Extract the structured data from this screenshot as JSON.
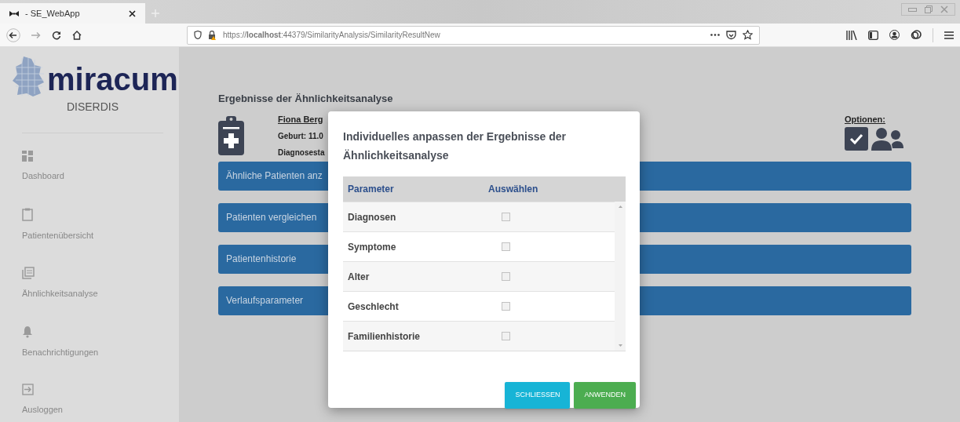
{
  "browser": {
    "tab_title": "- SE_WebApp",
    "url": "https://**localhost**:44379/SimilarityAnalysis/SimilarityResultNew"
  },
  "sidebar": {
    "logo": "miracum",
    "subtitle": "DISERDIS",
    "items": [
      {
        "kind": "dashboard",
        "label": "Dashboard"
      },
      {
        "kind": "clipboard",
        "label": "Patientenübersicht"
      },
      {
        "kind": "stack",
        "label": "Ähnlichkeitsanalyse"
      },
      {
        "kind": "bell",
        "label": "Benachrichtigungen"
      },
      {
        "kind": "logout",
        "label": "Ausloggen"
      }
    ]
  },
  "page": {
    "title": "Ergebnisse der Ähnlichkeitsanalyse",
    "patient_name": "Fiona Berg",
    "birth": "Geburt: 11.0",
    "diagnosis_status": "Diagnosesta",
    "options_label": "Optionen:",
    "actions": [
      "Ähnliche Patienten anz",
      "Patienten vergleichen",
      "Patientenhistorie",
      "Verlaufsparameter"
    ]
  },
  "dialog": {
    "title": "Individuelles anpassen der Ergebnisse der Ähnlichkeitsanalyse",
    "columns": [
      "Parameter",
      "Auswählen"
    ],
    "rows": [
      {
        "parameter": "Diagnosen",
        "checked": false
      },
      {
        "parameter": "Symptome",
        "checked": false
      },
      {
        "parameter": "Alter",
        "checked": false
      },
      {
        "parameter": "Geschlecht",
        "checked": false
      },
      {
        "parameter": "Familienhistorie",
        "checked": false
      }
    ],
    "buttons": [
      {
        "kind": "close",
        "label": "SCHLIESSEN"
      },
      {
        "kind": "apply",
        "label": "ANWENDEN"
      }
    ]
  }
}
